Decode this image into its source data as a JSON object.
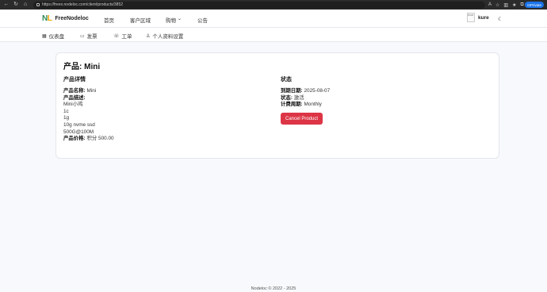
{
  "browser": {
    "url": "https://freex.nodeloc.com/client/products/3852",
    "private_label": "InPrivate"
  },
  "navbar": {
    "brand": "FreeNodeloc",
    "logo_n": "N",
    "logo_l": "L",
    "items": [
      "首页",
      "客户区域",
      "购物",
      "公告"
    ],
    "shop_chevron": "⌄",
    "avatar_alt": "Avat",
    "username": "kure"
  },
  "subnav": {
    "items": [
      "仪表盘",
      "发票",
      "工单",
      "个人资料设置"
    ]
  },
  "product": {
    "title": "产品: Mini",
    "details_heading": "产品详情",
    "name_label": "产品名称:",
    "name_value": " Mini",
    "desc_label": "产品描述:",
    "desc_lines": [
      "Mini小鸡",
      "1c",
      "1g",
      "10g nvme ssd",
      "500G@100M"
    ],
    "price_label": "产品价格:",
    "price_value": " 积分 500.00"
  },
  "status": {
    "heading": "状态",
    "expiry_label": "到期日期:",
    "expiry_value": " 2025-08-07",
    "state_label": "状态:",
    "state_value": " 激活",
    "cycle_label": "计费周期:",
    "cycle_value": " Monthly",
    "cancel_button": "Cancel Product"
  },
  "footer": "Nodeloc © 2022 - 2025",
  "colors": {
    "cancel": "#dc3545",
    "private": "#1a73e8",
    "page_bg": "#f8f9fc"
  }
}
